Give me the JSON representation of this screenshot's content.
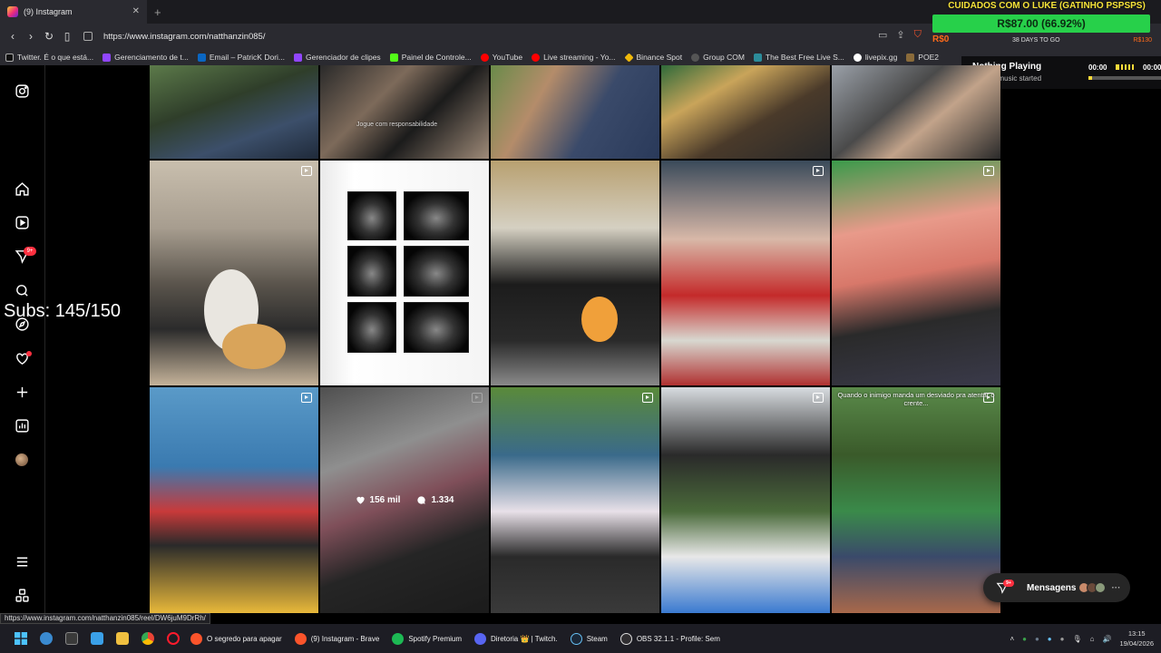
{
  "browser": {
    "tab": {
      "title": "(9) Instagram"
    },
    "url": "https://www.instagram.com/natthanzin085/",
    "bookmarks": [
      "Twitter. É o que está...",
      "Gerenciamento de t...",
      "Email – PatricK Dori...",
      "Gerenciador de clipes",
      "Painel de Controle...",
      "YouTube",
      "Live streaming - Yo...",
      "Binance Spot",
      "Group COM",
      "The Best Free Live S...",
      "livepix.gg",
      "POE2"
    ],
    "status_url": "https://www.instagram.com/natthanzin085/reel/DW6juM9DrRh/"
  },
  "overlay": {
    "stock_title": "CUIDADOS COM O LUKE (GATINHO PSPSPS)",
    "stock_price": "R$87.00 (66.92%)",
    "stock_left": "R$0",
    "stock_days": "38 DAYS TO GO",
    "stock_right": "R$130",
    "subs": "Subs: 145/150",
    "music_title": "Nothing Playing",
    "music_subtitle": "Get the music started",
    "music_time_start": "00:00",
    "music_time_end": "00:00",
    "music_progress": 0.05
  },
  "sidebar": {
    "notifications_badge": "9+"
  },
  "grid": {
    "hover_post": {
      "likes": "156 mil",
      "comments": "1.334"
    },
    "caption_overlay": "Quando o inimigo manda um desviado pra atentar o crente...",
    "watermark": "Jogue com responsabilidade"
  },
  "messages": {
    "label": "Mensagens",
    "badge": "9+"
  },
  "taskbar": {
    "apps": [
      "O segredo para apagar",
      "(9) Instagram - Brave",
      "Spotify Premium",
      "Diretoria 👑 | Twitch.",
      "Steam",
      "OBS 32.1.1 - Profile: Sem"
    ],
    "time": "13:15",
    "date": "19/04/2026"
  },
  "colors": {
    "accent_red": "#ff3040",
    "stock_green": "#27d04a",
    "stock_yellow": "#f7e43a"
  }
}
